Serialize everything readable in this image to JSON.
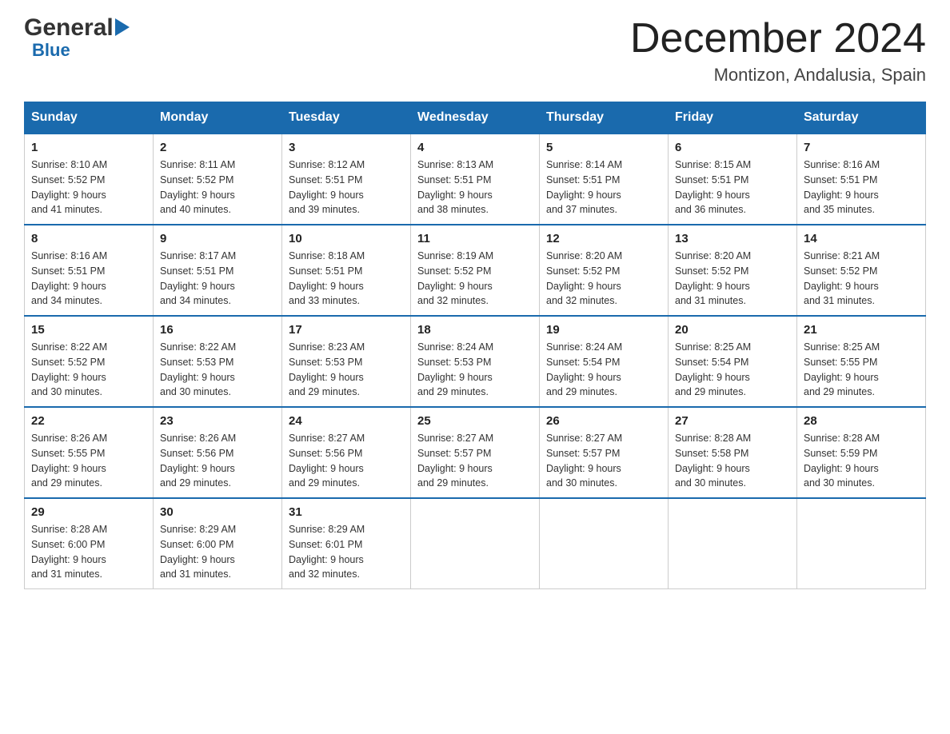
{
  "logo": {
    "general": "General",
    "triangle": "▶",
    "blue": "Blue"
  },
  "title": "December 2024",
  "location": "Montizon, Andalusia, Spain",
  "days_of_week": [
    "Sunday",
    "Monday",
    "Tuesday",
    "Wednesday",
    "Thursday",
    "Friday",
    "Saturday"
  ],
  "weeks": [
    [
      {
        "day": "1",
        "sunrise": "8:10 AM",
        "sunset": "5:52 PM",
        "daylight": "9 hours and 41 minutes."
      },
      {
        "day": "2",
        "sunrise": "8:11 AM",
        "sunset": "5:52 PM",
        "daylight": "9 hours and 40 minutes."
      },
      {
        "day": "3",
        "sunrise": "8:12 AM",
        "sunset": "5:51 PM",
        "daylight": "9 hours and 39 minutes."
      },
      {
        "day": "4",
        "sunrise": "8:13 AM",
        "sunset": "5:51 PM",
        "daylight": "9 hours and 38 minutes."
      },
      {
        "day": "5",
        "sunrise": "8:14 AM",
        "sunset": "5:51 PM",
        "daylight": "9 hours and 37 minutes."
      },
      {
        "day": "6",
        "sunrise": "8:15 AM",
        "sunset": "5:51 PM",
        "daylight": "9 hours and 36 minutes."
      },
      {
        "day": "7",
        "sunrise": "8:16 AM",
        "sunset": "5:51 PM",
        "daylight": "9 hours and 35 minutes."
      }
    ],
    [
      {
        "day": "8",
        "sunrise": "8:16 AM",
        "sunset": "5:51 PM",
        "daylight": "9 hours and 34 minutes."
      },
      {
        "day": "9",
        "sunrise": "8:17 AM",
        "sunset": "5:51 PM",
        "daylight": "9 hours and 34 minutes."
      },
      {
        "day": "10",
        "sunrise": "8:18 AM",
        "sunset": "5:51 PM",
        "daylight": "9 hours and 33 minutes."
      },
      {
        "day": "11",
        "sunrise": "8:19 AM",
        "sunset": "5:52 PM",
        "daylight": "9 hours and 32 minutes."
      },
      {
        "day": "12",
        "sunrise": "8:20 AM",
        "sunset": "5:52 PM",
        "daylight": "9 hours and 32 minutes."
      },
      {
        "day": "13",
        "sunrise": "8:20 AM",
        "sunset": "5:52 PM",
        "daylight": "9 hours and 31 minutes."
      },
      {
        "day": "14",
        "sunrise": "8:21 AM",
        "sunset": "5:52 PM",
        "daylight": "9 hours and 31 minutes."
      }
    ],
    [
      {
        "day": "15",
        "sunrise": "8:22 AM",
        "sunset": "5:52 PM",
        "daylight": "9 hours and 30 minutes."
      },
      {
        "day": "16",
        "sunrise": "8:22 AM",
        "sunset": "5:53 PM",
        "daylight": "9 hours and 30 minutes."
      },
      {
        "day": "17",
        "sunrise": "8:23 AM",
        "sunset": "5:53 PM",
        "daylight": "9 hours and 29 minutes."
      },
      {
        "day": "18",
        "sunrise": "8:24 AM",
        "sunset": "5:53 PM",
        "daylight": "9 hours and 29 minutes."
      },
      {
        "day": "19",
        "sunrise": "8:24 AM",
        "sunset": "5:54 PM",
        "daylight": "9 hours and 29 minutes."
      },
      {
        "day": "20",
        "sunrise": "8:25 AM",
        "sunset": "5:54 PM",
        "daylight": "9 hours and 29 minutes."
      },
      {
        "day": "21",
        "sunrise": "8:25 AM",
        "sunset": "5:55 PM",
        "daylight": "9 hours and 29 minutes."
      }
    ],
    [
      {
        "day": "22",
        "sunrise": "8:26 AM",
        "sunset": "5:55 PM",
        "daylight": "9 hours and 29 minutes."
      },
      {
        "day": "23",
        "sunrise": "8:26 AM",
        "sunset": "5:56 PM",
        "daylight": "9 hours and 29 minutes."
      },
      {
        "day": "24",
        "sunrise": "8:27 AM",
        "sunset": "5:56 PM",
        "daylight": "9 hours and 29 minutes."
      },
      {
        "day": "25",
        "sunrise": "8:27 AM",
        "sunset": "5:57 PM",
        "daylight": "9 hours and 29 minutes."
      },
      {
        "day": "26",
        "sunrise": "8:27 AM",
        "sunset": "5:57 PM",
        "daylight": "9 hours and 30 minutes."
      },
      {
        "day": "27",
        "sunrise": "8:28 AM",
        "sunset": "5:58 PM",
        "daylight": "9 hours and 30 minutes."
      },
      {
        "day": "28",
        "sunrise": "8:28 AM",
        "sunset": "5:59 PM",
        "daylight": "9 hours and 30 minutes."
      }
    ],
    [
      {
        "day": "29",
        "sunrise": "8:28 AM",
        "sunset": "6:00 PM",
        "daylight": "9 hours and 31 minutes."
      },
      {
        "day": "30",
        "sunrise": "8:29 AM",
        "sunset": "6:00 PM",
        "daylight": "9 hours and 31 minutes."
      },
      {
        "day": "31",
        "sunrise": "8:29 AM",
        "sunset": "6:01 PM",
        "daylight": "9 hours and 32 minutes."
      },
      null,
      null,
      null,
      null
    ]
  ],
  "labels": {
    "sunrise": "Sunrise:",
    "sunset": "Sunset:",
    "daylight": "Daylight:"
  }
}
